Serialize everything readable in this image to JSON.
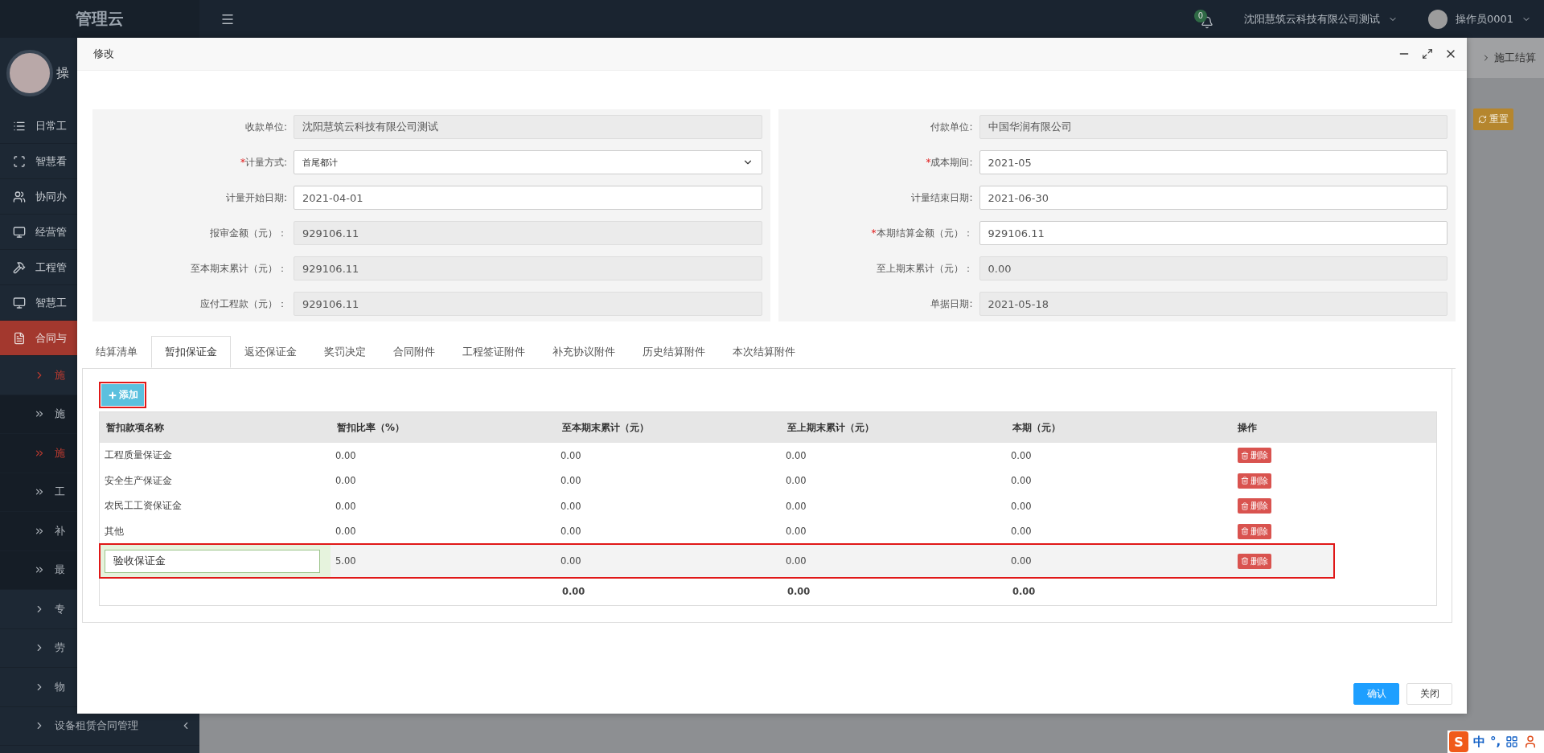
{
  "app": {
    "title": "管理云"
  },
  "user_panel": {
    "name": "操"
  },
  "sidebar": {
    "items": [
      {
        "label": "日常工",
        "selected": false
      },
      {
        "label": "智慧看",
        "selected": false
      },
      {
        "label": "协同办",
        "selected": false
      },
      {
        "label": "经营管",
        "selected": false
      },
      {
        "label": "工程管",
        "selected": false
      },
      {
        "label": "智慧工",
        "selected": false
      },
      {
        "label": "合同与",
        "selected": true,
        "children": [
          {
            "label": "施",
            "kind": "group",
            "selected": true
          },
          {
            "label": "施",
            "kind": "page",
            "selected": false
          },
          {
            "label": "施",
            "kind": "page",
            "selected": true
          },
          {
            "label": "工",
            "kind": "page",
            "selected": false
          },
          {
            "label": "补",
            "kind": "page",
            "selected": false
          },
          {
            "label": "最",
            "kind": "page",
            "selected": false
          },
          {
            "label": "专",
            "kind": "group",
            "selected": false
          },
          {
            "label": "劳",
            "kind": "group",
            "selected": false
          },
          {
            "label": "物",
            "kind": "group",
            "selected": false
          },
          {
            "label": "设备租赁合同管理",
            "kind": "group",
            "selected": false,
            "collapsible": true
          }
        ]
      }
    ]
  },
  "topbar": {
    "notifications": "0",
    "company": "沈阳慧筑云科技有限公司测试",
    "user": "操作员0001"
  },
  "breadcrumb": {
    "current": "施工结算"
  },
  "reset_button": "重置",
  "modal": {
    "title": "修改",
    "form": {
      "left": [
        {
          "label": "收款单位:",
          "value": "沈阳慧筑云科技有限公司测试",
          "kind": "input",
          "readonly": true
        },
        {
          "mark": "*",
          "label": "计量方式:",
          "value": "首尾都计",
          "kind": "select",
          "readonly": false
        },
        {
          "label": "计量开始日期:",
          "value": "2021-04-01",
          "kind": "input",
          "readonly": false
        },
        {
          "label": "报审金额（元）：",
          "value": "929106.11",
          "kind": "input",
          "readonly": true
        },
        {
          "label": "至本期末累计（元）：",
          "value": "929106.11",
          "kind": "input",
          "readonly": true
        },
        {
          "label": "应付工程款（元）：",
          "value": "929106.11",
          "kind": "input",
          "readonly": true
        }
      ],
      "right": [
        {
          "label": "付款单位:",
          "value": "中国华润有限公司",
          "kind": "input",
          "readonly": true
        },
        {
          "mark": "*",
          "label": "成本期间:",
          "value": "2021-05",
          "kind": "input",
          "readonly": false
        },
        {
          "label": "计量结束日期:",
          "value": "2021-06-30",
          "kind": "input",
          "readonly": false
        },
        {
          "mark": "*",
          "label": "本期结算金额（元）：",
          "value": "929106.11",
          "kind": "input",
          "readonly": false
        },
        {
          "label": "至上期末累计（元）：",
          "value": "0.00",
          "kind": "input",
          "readonly": true
        },
        {
          "label": "单据日期:",
          "value": "2021-05-18",
          "kind": "input",
          "readonly": true
        }
      ]
    },
    "tabs": [
      {
        "label": "结算清单",
        "selected": false
      },
      {
        "label": "暂扣保证金",
        "selected": true
      },
      {
        "label": "返还保证金",
        "selected": false
      },
      {
        "label": "奖罚决定",
        "selected": false
      },
      {
        "label": "合同附件",
        "selected": false
      },
      {
        "label": "工程签证附件",
        "selected": false
      },
      {
        "label": "补充协议附件",
        "selected": false
      },
      {
        "label": "历史结算附件",
        "selected": false
      },
      {
        "label": "本次结算附件",
        "selected": false
      }
    ],
    "add_button": {
      "label": "添加",
      "highlighted": true
    },
    "table": {
      "columns": [
        "暂扣款项名称",
        "暂扣比率（%）",
        "至本期末累计（元）",
        "至上期末累计（元）",
        "本期（元）",
        "操作"
      ],
      "rows": [
        {
          "kind": "text",
          "highlighted": false,
          "cells": [
            "工程质量保证金",
            "0.00",
            "0.00",
            "0.00",
            "0.00"
          ],
          "action": "删除"
        },
        {
          "kind": "text",
          "highlighted": false,
          "cells": [
            "安全生产保证金",
            "0.00",
            "0.00",
            "0.00",
            "0.00"
          ],
          "action": "删除"
        },
        {
          "kind": "text",
          "highlighted": false,
          "cells": [
            "农民工工资保证金",
            "0.00",
            "0.00",
            "0.00",
            "0.00"
          ],
          "action": "删除"
        },
        {
          "kind": "text",
          "highlighted": false,
          "cells": [
            "其他",
            "0.00",
            "0.00",
            "0.00",
            "0.00"
          ],
          "action": "删除"
        },
        {
          "kind": "editing",
          "highlighted": true,
          "cells": [
            "验收保证金",
            "5.00",
            "0.00",
            "0.00",
            "0.00"
          ],
          "action": "删除"
        }
      ],
      "totals": [
        "0.00",
        "0.00",
        "0.00"
      ]
    },
    "buttons": [
      {
        "label": "确认",
        "kind": "primary"
      },
      {
        "label": "关闭",
        "kind": "default"
      }
    ]
  },
  "ime_toolbar": {
    "logo": "S",
    "mode": "中",
    "punctuation": "°,"
  }
}
